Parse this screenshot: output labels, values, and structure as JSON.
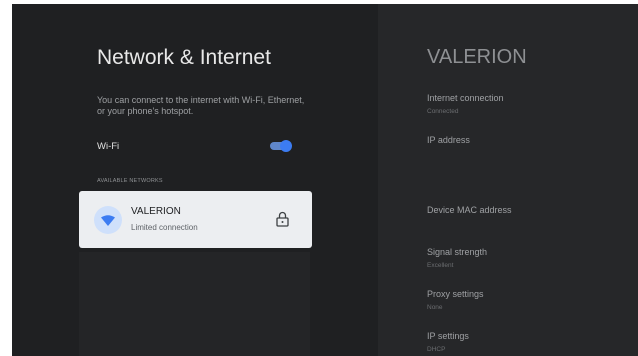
{
  "left": {
    "title": "Network & Internet",
    "description": "You can connect to the internet with Wi-Fi, Ethernet, or your phone's hotspot.",
    "wifi_label": "Wi-Fi",
    "wifi_enabled": true,
    "available_networks_header": "AVAILABLE NETWORKS",
    "network": {
      "name": "VALERION",
      "status": "Limited connection",
      "secured": true
    }
  },
  "right": {
    "title": "VALERION",
    "items": [
      {
        "label": "Internet connection",
        "value": "Connected"
      },
      {
        "label": "IP address",
        "value": ""
      },
      {
        "label": "Device MAC address",
        "value": ""
      },
      {
        "label": "Signal strength",
        "value": "Excellent"
      },
      {
        "label": "Proxy settings",
        "value": "None"
      },
      {
        "label": "IP settings",
        "value": "DHCP"
      }
    ]
  },
  "colors": {
    "accent": "#3c7cf2",
    "background": "#1f2022",
    "panel": "#262729",
    "card": "#eceef1"
  }
}
